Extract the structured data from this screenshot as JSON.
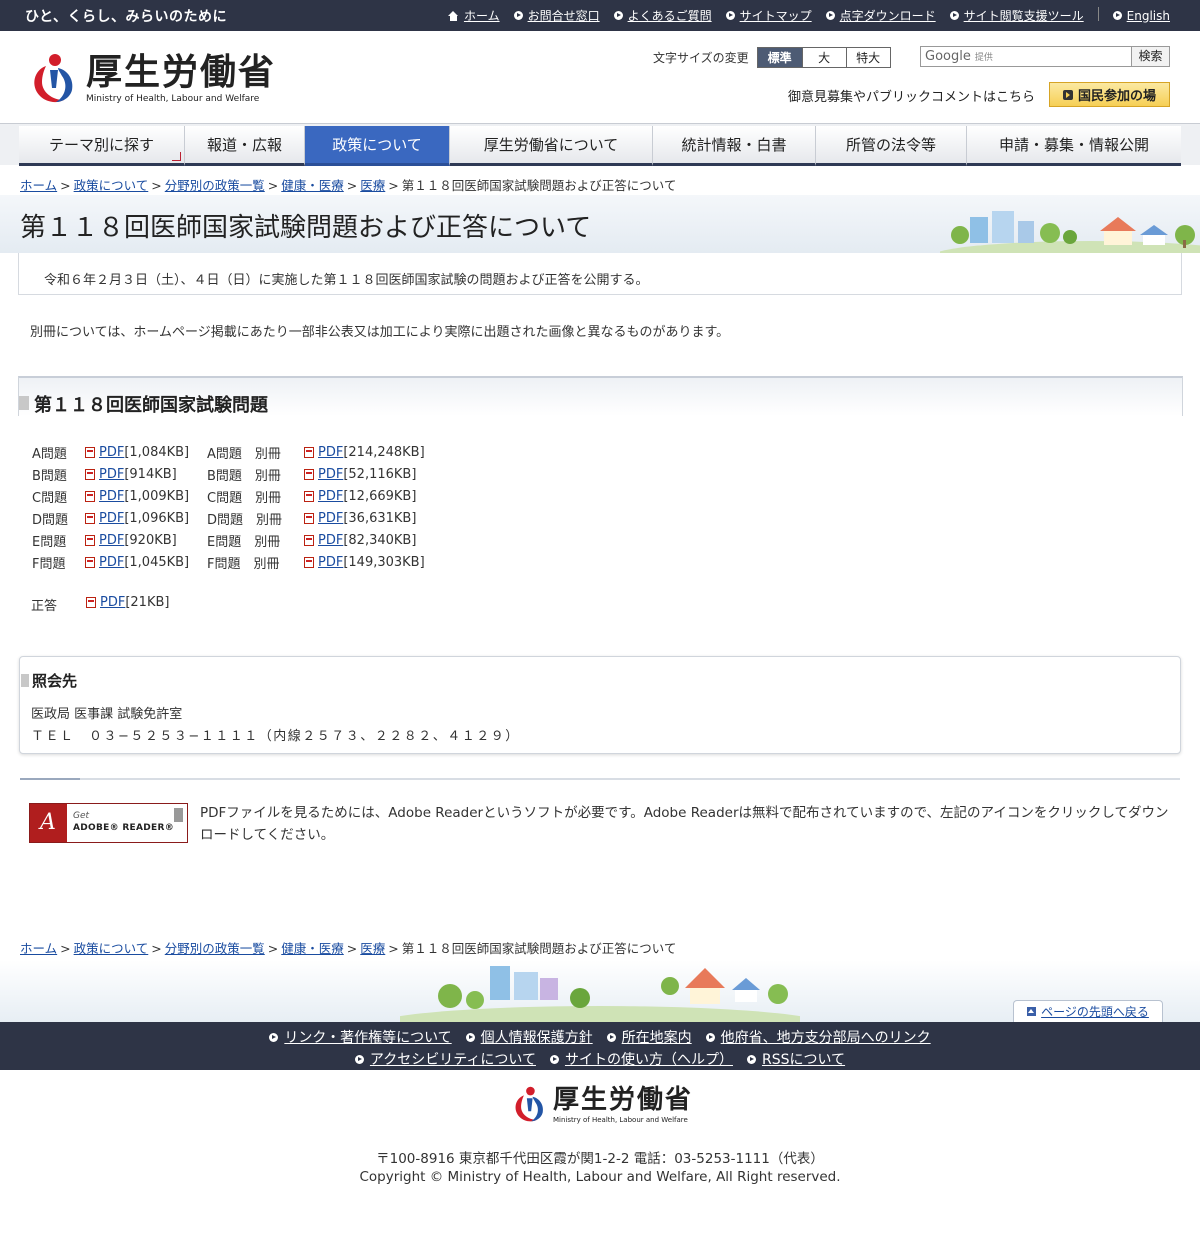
{
  "topbar": {
    "tagline": "ひと、くらし、みらいのために",
    "links": [
      {
        "label": "ホーム",
        "icon": "home-icon"
      },
      {
        "label": "お問合せ窓口",
        "icon": "bullet-icon"
      },
      {
        "label": "よくあるご質問",
        "icon": "bullet-icon"
      },
      {
        "label": "サイトマップ",
        "icon": "bullet-icon"
      },
      {
        "label": "点字ダウンロード",
        "icon": "bullet-icon"
      },
      {
        "label": "サイト閲覧支援ツール",
        "icon": "bullet-icon"
      },
      {
        "label": "English",
        "icon": "bullet-icon"
      }
    ]
  },
  "header": {
    "logo_jp": "厚生労働省",
    "logo_en": "Ministry of Health, Labour and Welfare",
    "font_size_label": "文字サイズの変更",
    "font_sizes": [
      "標準",
      "大",
      "特大"
    ],
    "search_brand": "Google",
    "search_provided": "提供",
    "search_button": "検索",
    "opinion_text": "御意見募集やパブリックコメントはこちら",
    "kokumin_button": "国民参加の場"
  },
  "gnav": [
    {
      "label": "テーマ別に探す",
      "active": false
    },
    {
      "label": "報道・広報",
      "active": false
    },
    {
      "label": "政策について",
      "active": true
    },
    {
      "label": "厚生労働省について",
      "active": false
    },
    {
      "label": "統計情報・白書",
      "active": false
    },
    {
      "label": "所管の法令等",
      "active": false
    },
    {
      "label": "申請・募集・情報公開",
      "active": false
    }
  ],
  "breadcrumb": {
    "links": [
      "ホーム",
      "政策について",
      "分野別の政策一覧",
      "健康・医療",
      "医療"
    ],
    "current": "第１１８回医師国家試験問題および正答について"
  },
  "page": {
    "title": "第１１８回医師国家試験問題および正答について",
    "lead": "令和６年２月３日（土）、４日（日）に実施した第１１８回医師国家試験の問題および正答を公開する。",
    "note": "別冊については、ホームページ掲載にあたり一部非公表又は加工により実際に出題された画像と異なるものがあります。"
  },
  "section": {
    "heading": "第１１８回医師国家試験問題",
    "rows": [
      {
        "label": "A問題",
        "link": "PDF",
        "size": "[1,084KB]",
        "extra_label": "A問題　別冊",
        "extra_link": "PDF",
        "extra_size": "[214,248KB]"
      },
      {
        "label": "B問題",
        "link": "PDF",
        "size": "[914KB]",
        "extra_label": "B問題　別冊",
        "extra_link": "PDF",
        "extra_size": "[52,116KB]"
      },
      {
        "label": "C問題",
        "link": "PDF",
        "size": "[1,009KB]",
        "extra_label": "C問題　別冊",
        "extra_link": "PDF",
        "extra_size": "[12,669KB]"
      },
      {
        "label": "D問題",
        "link": "PDF",
        "size": "[1,096KB]",
        "extra_label": "D問題　別冊",
        "extra_link": "PDF",
        "extra_size": "[36,631KB]"
      },
      {
        "label": "E問題",
        "link": "PDF",
        "size": "[920KB]",
        "extra_label": "E問題　別冊",
        "extra_link": "PDF",
        "extra_size": "[82,340KB]"
      },
      {
        "label": "F問題",
        "link": "PDF",
        "size": "[1,045KB]",
        "extra_label": "F問題　別冊",
        "extra_link": "PDF",
        "extra_size": "[149,303KB]"
      }
    ],
    "answer_label": "正答",
    "answer_link": "PDF",
    "answer_size": "[21KB]"
  },
  "contact": {
    "heading": "照会先",
    "line1": "医政局 医事課 試験免許室",
    "line2": "ＴＥＬ　０３−５２５３−１１１１（内線２５７３、２２８２、４１２９）"
  },
  "adobe": {
    "badge_get": "Get",
    "badge_name": "ADOBE® READER®",
    "text": "PDFファイルを見るためには、Adobe Readerというソフトが必要です。Adobe Readerは無料で配布されていますので、左記のアイコンをクリックしてダウンロードしてください。"
  },
  "pagetop": "ページの先頭へ戻る",
  "footer": {
    "row1": [
      "リンク・著作権等について",
      "個人情報保護方針",
      "所在地案内",
      "他府省、地方支分部局へのリンク"
    ],
    "row2": [
      "アクセシビリティについて",
      "サイトの使い方（ヘルプ）",
      "RSSについて"
    ],
    "logo_jp": "厚生労働省",
    "logo_en": "Ministry of Health, Labour and Welfare",
    "address": "〒100-8916 東京都千代田区霞が関1-2-2 電話：03-5253-1111（代表）",
    "copyright": "Copyright © Ministry of Health, Labour and Welfare, All Right reserved."
  },
  "colors": {
    "topbar": "#2e3446",
    "nav_active": "#3a68c0",
    "link": "#1a4ca0",
    "logo_red": "#d21e2b",
    "logo_blue": "#2355a5"
  }
}
